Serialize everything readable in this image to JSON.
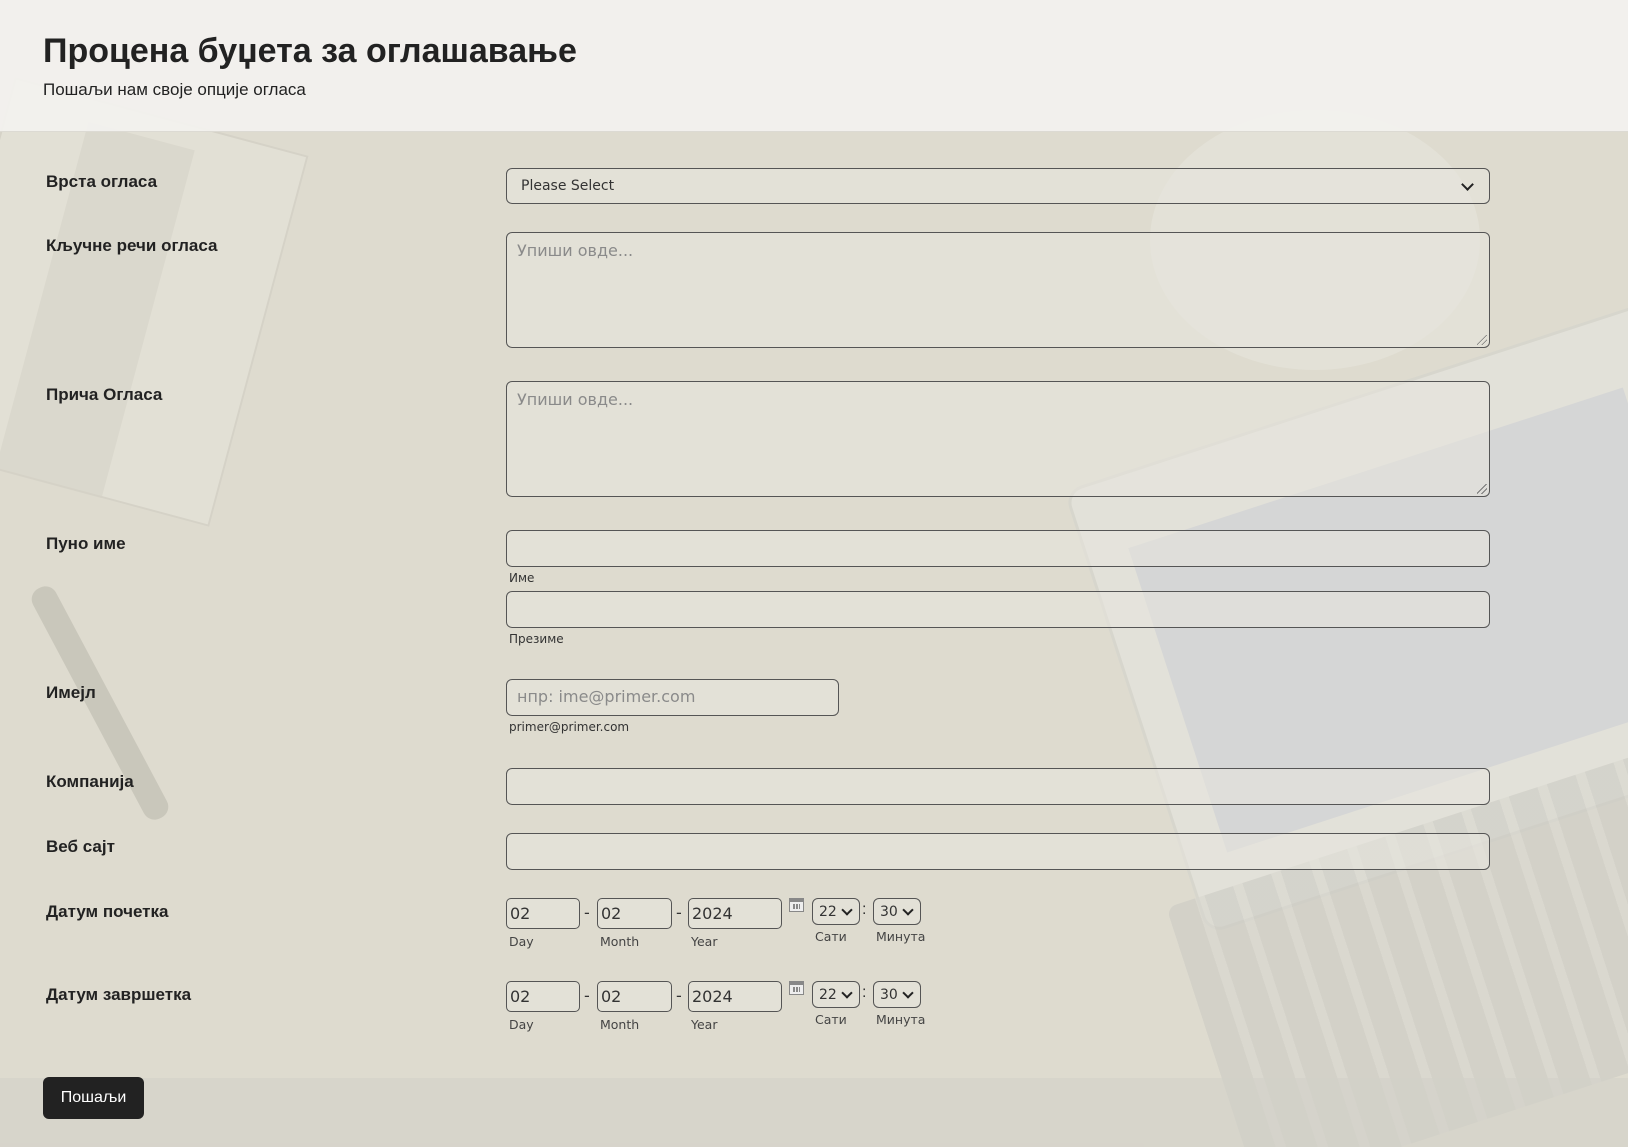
{
  "header": {
    "title": "Процена буџета за оглашавање",
    "subtitle": "Пошаљи нам своје опције огласа"
  },
  "fields": {
    "ad_type": {
      "label": "Врста огласа",
      "value": "Please Select"
    },
    "keywords": {
      "label": "Кључне речи огласа",
      "placeholder": "Упиши овде..."
    },
    "story": {
      "label": "Прича Огласа",
      "placeholder": "Упиши овде..."
    },
    "full_name": {
      "label": "Пуно име",
      "first_sublabel": "Име",
      "last_sublabel": "Презиме"
    },
    "email": {
      "label": "Имејл",
      "placeholder": "нпр: ime@primer.com",
      "sublabel": "primer@primer.com"
    },
    "company": {
      "label": "Компанија"
    },
    "website": {
      "label": "Веб сајт"
    },
    "start_date": {
      "label": "Датум почетка",
      "day": "02",
      "month": "02",
      "year": "2024",
      "hour": "22",
      "minute": "30",
      "day_label": "Day",
      "month_label": "Month",
      "year_label": "Year",
      "hour_label": "Сати",
      "minute_label": "Минута"
    },
    "end_date": {
      "label": "Датум завршетка",
      "day": "02",
      "month": "02",
      "year": "2024",
      "hour": "22",
      "minute": "30",
      "day_label": "Day",
      "month_label": "Month",
      "year_label": "Year",
      "hour_label": "Сати",
      "minute_label": "Минута"
    }
  },
  "date_separator": "-",
  "time_separator": ":",
  "submit_label": "Пошаљи",
  "icons": {
    "select_arrow": "chevron-down-icon",
    "calendar": "calendar-icon",
    "resize": "resize-grip-icon"
  },
  "colors": {
    "button_bg": "#222222",
    "button_text": "#ffffff",
    "header_bg": "#f2f1ee"
  }
}
